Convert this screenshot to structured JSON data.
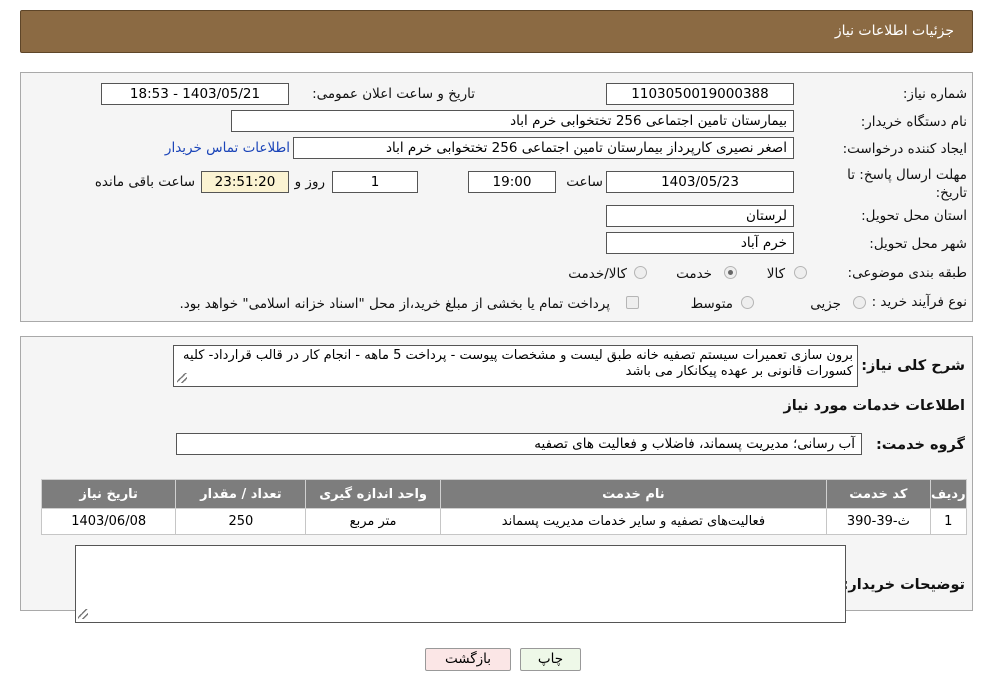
{
  "header": {
    "title": "جزئیات اطلاعات نیاز"
  },
  "form": {
    "need_number_label": "شماره نیاز:",
    "need_number": "1103050019000388",
    "announce_label": "تاریخ و ساعت اعلان عمومی:",
    "announce_value": "1403/05/21 - 18:53",
    "buyer_org_label": "نام دستگاه خریدار:",
    "buyer_org": "بیمارستان تامین اجتماعی  256 تختخوابی خرم اباد",
    "creator_label": "ایجاد کننده درخواست:",
    "creator": "اصغر نصیری کارپرداز بیمارستان تامین اجتماعی  256 تختخوابی خرم اباد",
    "contact_link": "اطلاعات تماس خریدار",
    "deadline_label": "مهلت ارسال پاسخ: تا تاریخ:",
    "deadline_date": "1403/05/23",
    "time_label": "ساعت",
    "deadline_time": "19:00",
    "days_value": "1",
    "days_label": "روز و",
    "remaining_time": "23:51:20",
    "remaining_label": "ساعت باقی مانده",
    "province_label": "استان محل تحویل:",
    "province": "لرستان",
    "city_label": "شهر محل تحویل:",
    "city": "خرم آباد",
    "category_label": "طبقه بندی موضوعی:",
    "category_options": [
      "کالا",
      "خدمت",
      "کالا/خدمت"
    ],
    "category_selected": "خدمت",
    "process_label": "نوع فرآیند خرید :",
    "process_options": [
      "جزیی",
      "متوسط"
    ],
    "process_note": "پرداخت تمام یا بخشی از مبلغ خرید،از محل \"اسناد خزانه اسلامی\" خواهد بود."
  },
  "description": {
    "label": "شرح کلی نیاز:",
    "text": "برون سازی  تعمیرات سیستم تصفیه خانه طبق لیست و مشخصات پیوست - پرداخت 5 ماهه - انجام کار در قالب قرارداد- کلیه کسورات قانونی بر عهده پیکانکار می باشد"
  },
  "services": {
    "section_title": "اطلاعات خدمات مورد نیاز",
    "group_label": "گروه خدمت:",
    "group_value": "آب رسانی؛ مدیریت پسماند، فاضلاب و فعالیت های تصفیه",
    "columns": [
      "ردیف",
      "کد خدمت",
      "نام خدمت",
      "واحد اندازه گیری",
      "تعداد / مقدار",
      "تاریخ نیاز"
    ],
    "rows": [
      [
        "1",
        "ث-39-390",
        "فعالیت‌های تصفیه و سایر خدمات مدیریت پسماند",
        "متر مربع",
        "250",
        "1403/06/08"
      ]
    ]
  },
  "buyer_notes": {
    "label": "توضیحات خریدار:",
    "value": ""
  },
  "buttons": {
    "print": "چاپ",
    "back": "بازگشت"
  },
  "colors": {
    "header_bg": "#8b6a43",
    "table_header_bg": "#7d7d7d",
    "print_bg": "#eef8e8",
    "back_bg": "#fbe6e6",
    "timer_bg": "#fbf3d2"
  }
}
